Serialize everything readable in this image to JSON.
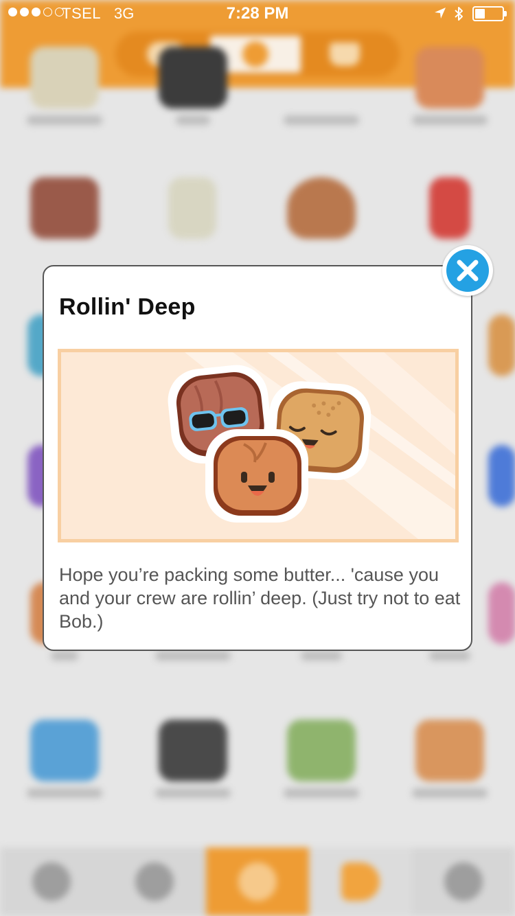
{
  "status_bar": {
    "carrier": "TSEL",
    "network": "3G",
    "time": "7:28 PM",
    "signal_dots_filled": 3,
    "signal_dots_total": 5,
    "icons": [
      "location-arrow-icon",
      "bluetooth-icon",
      "battery-icon"
    ],
    "battery_level": 0.25
  },
  "header": {
    "segments": [
      "cloud-icon",
      "food-icon",
      "crown-icon"
    ],
    "selected_segment": 1,
    "color": "#ee9c34"
  },
  "bottom_tabs": {
    "items": [
      "friends-icon",
      "camera-icon",
      "compass-icon",
      "stickers-icon",
      "profile-icon"
    ],
    "active_index": 2
  },
  "modal": {
    "title": "Rollin' Deep",
    "description": "Hope you’re packing some butter... 'cause you and your crew are rollin’ deep. (Just try not to eat Bob.)",
    "image": "bread-rolls-sticker",
    "close_icon": "close-icon",
    "close_color": "#24a1e3"
  }
}
